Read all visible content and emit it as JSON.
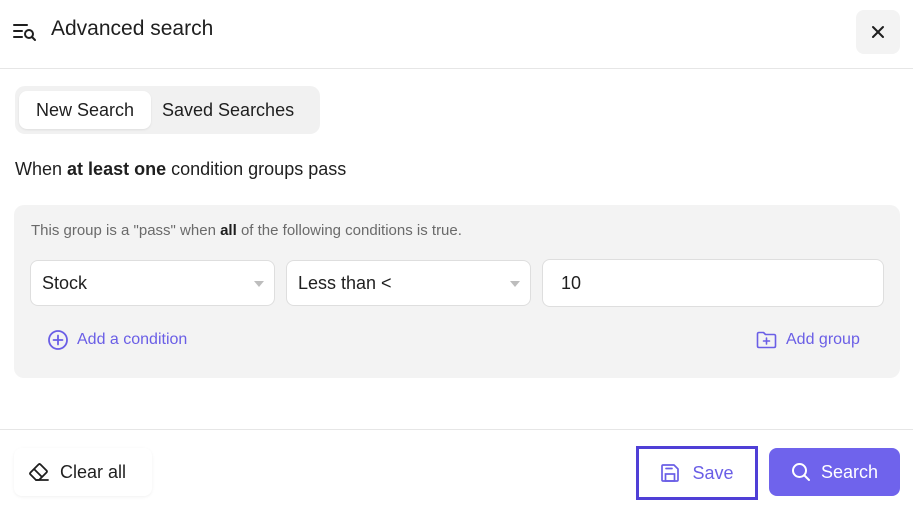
{
  "header": {
    "title": "Advanced search",
    "close_icon": "close-icon",
    "title_icon": "filter-search-icon"
  },
  "tabs": [
    {
      "label": "New Search",
      "active": true
    },
    {
      "label": "Saved Searches",
      "active": false
    }
  ],
  "match_rule": {
    "prefix": "When",
    "emphasis": "at least one",
    "suffix": "condition groups pass"
  },
  "group": {
    "desc_prefix": "This group is a \"pass\" when",
    "desc_emphasis": "all",
    "desc_suffix": "of the following conditions is true.",
    "condition": {
      "field": "Stock",
      "operator": "Less than <",
      "value": "10"
    },
    "add_condition_label": "Add a condition",
    "add_group_label": "Add group"
  },
  "footer": {
    "clear_label": "Clear all",
    "save_label": "Save",
    "search_label": "Search"
  },
  "colors": {
    "accent": "#6f63ec",
    "accent_text": "#6a5ee6",
    "focus_border": "#4f3fd6"
  }
}
